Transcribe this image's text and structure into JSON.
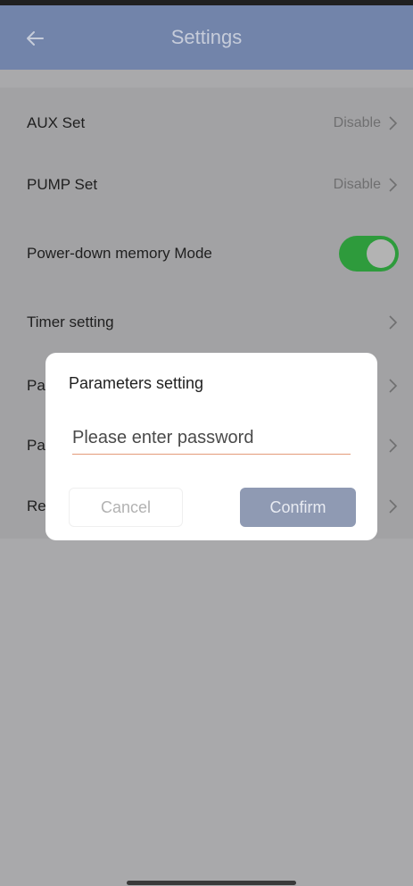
{
  "header": {
    "title": "Settings",
    "back_icon": "arrow-left-icon"
  },
  "settings": {
    "aux": {
      "label": "AUX Set",
      "value": "Disable"
    },
    "pump": {
      "label": "PUMP Set",
      "value": "Disable"
    },
    "power_down": {
      "label": "Power-down memory Mode",
      "enabled": true
    },
    "timer": {
      "label": "Timer setting"
    },
    "param1": {
      "label": "Pa"
    },
    "param2": {
      "label": "Pa"
    },
    "reset": {
      "label": "Re"
    }
  },
  "dialog": {
    "title": "Parameters setting",
    "input_placeholder": "Please enter password",
    "cancel_label": "Cancel",
    "confirm_label": "Confirm"
  },
  "colors": {
    "header": "#7284aa",
    "toggle_on": "#2e9b3c",
    "confirm_button": "#8f9ab3",
    "input_underline": "#e39b7a"
  }
}
